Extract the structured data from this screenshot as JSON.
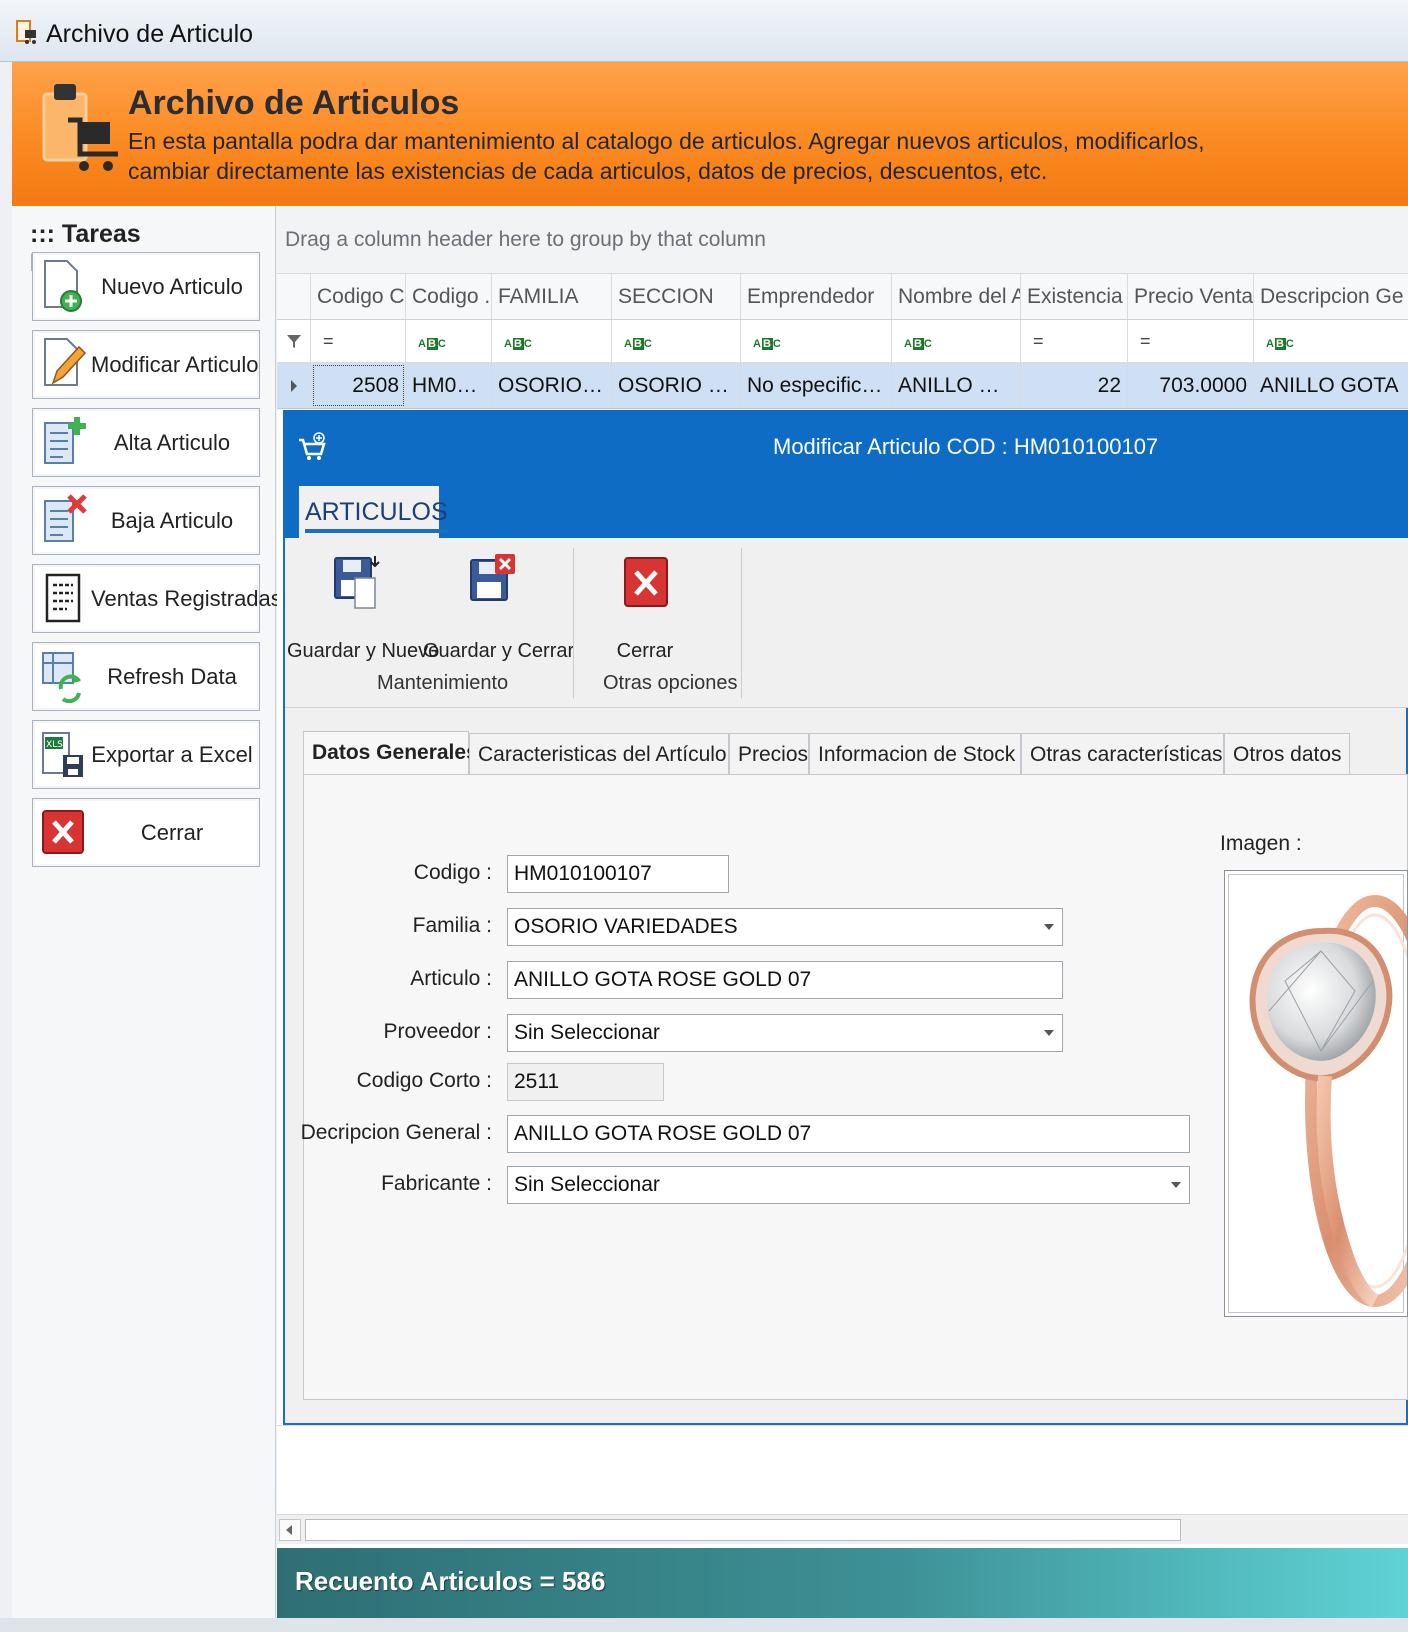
{
  "window": {
    "title": "Archivo de Articulo"
  },
  "header": {
    "title": "Archivo de Articulos",
    "description": "En esta pantalla podra dar mantenimiento al catalogo de articulos. Agregar nuevos articulos, modificarlos, cambiar directamente las existencias de cada articulos, datos de precios, descuentos, etc."
  },
  "sidebar": {
    "title": "::: Tareas Disponibles :::",
    "items": [
      {
        "label": "Nuevo Articulo",
        "icon": "new-document-icon"
      },
      {
        "label": "Modificar Articulo",
        "icon": "edit-document-icon"
      },
      {
        "label": "Alta Articulo",
        "icon": "add-list-icon"
      },
      {
        "label": "Baja Articulo",
        "icon": "remove-list-icon"
      },
      {
        "label": "Ventas Registradas",
        "icon": "report-icon"
      },
      {
        "label": "Refresh Data",
        "icon": "refresh-icon"
      },
      {
        "label": "Exportar a Excel",
        "icon": "excel-export-icon"
      },
      {
        "label": "Cerrar",
        "icon": "close-icon"
      }
    ]
  },
  "grid": {
    "group_hint": "Drag a column header here to group by that column",
    "columns": [
      "Codigo C...",
      "Codigo ...",
      "FAMILIA",
      "SECCION",
      "Emprendedor",
      "Nombre del Ar...",
      "Existencia",
      "Precio Venta",
      "Descripcion Ge"
    ],
    "filters": [
      "=",
      "abc",
      "abc",
      "abc",
      "abc",
      "abc",
      "=",
      "=",
      "abc"
    ],
    "row": [
      "2508",
      "HM0101...",
      "OSORIO VA...",
      "OSORIO VARI...",
      "No especificado",
      "ANILLO GOTA...",
      "22",
      "703.0000",
      "ANILLO GOTA"
    ]
  },
  "dialog": {
    "title": "Modificar Articulo COD : HM010100107",
    "ribbon_tab": "ARTICULOS",
    "buttons": {
      "save_new": "Guardar y Nuevo",
      "save_close": "Guardar y Cerrar",
      "close": "Cerrar"
    },
    "groups": {
      "maintenance": "Mantenimiento",
      "other": "Otras opciones"
    },
    "tabs": [
      "Datos Generales",
      "Caracteristicas del Artículo",
      "Precios",
      "Informacion de Stock",
      "Otras características",
      "Otros datos"
    ],
    "form": {
      "codigo": {
        "label": "Codigo :",
        "value": "HM010100107"
      },
      "familia": {
        "label": "Familia :",
        "value": "OSORIO VARIEDADES"
      },
      "articulo": {
        "label": "Articulo :",
        "value": "ANILLO GOTA ROSE GOLD 07"
      },
      "proveedor": {
        "label": "Proveedor :",
        "value": "Sin Seleccionar"
      },
      "codigo_corto": {
        "label": "Codigo Corto :",
        "value": "2511"
      },
      "descripcion": {
        "label": "Decripcion General :",
        "value": "ANILLO GOTA ROSE GOLD 07"
      },
      "fabricante": {
        "label": "Fabricante :",
        "value": "Sin Seleccionar"
      }
    },
    "image_label": "Imagen :"
  },
  "status": {
    "text": "Recuento Articulos = 586"
  },
  "colors": {
    "header_orange": "#fb8a22",
    "dialog_blue": "#0f6cc4",
    "status_teal": "#3d9196"
  }
}
